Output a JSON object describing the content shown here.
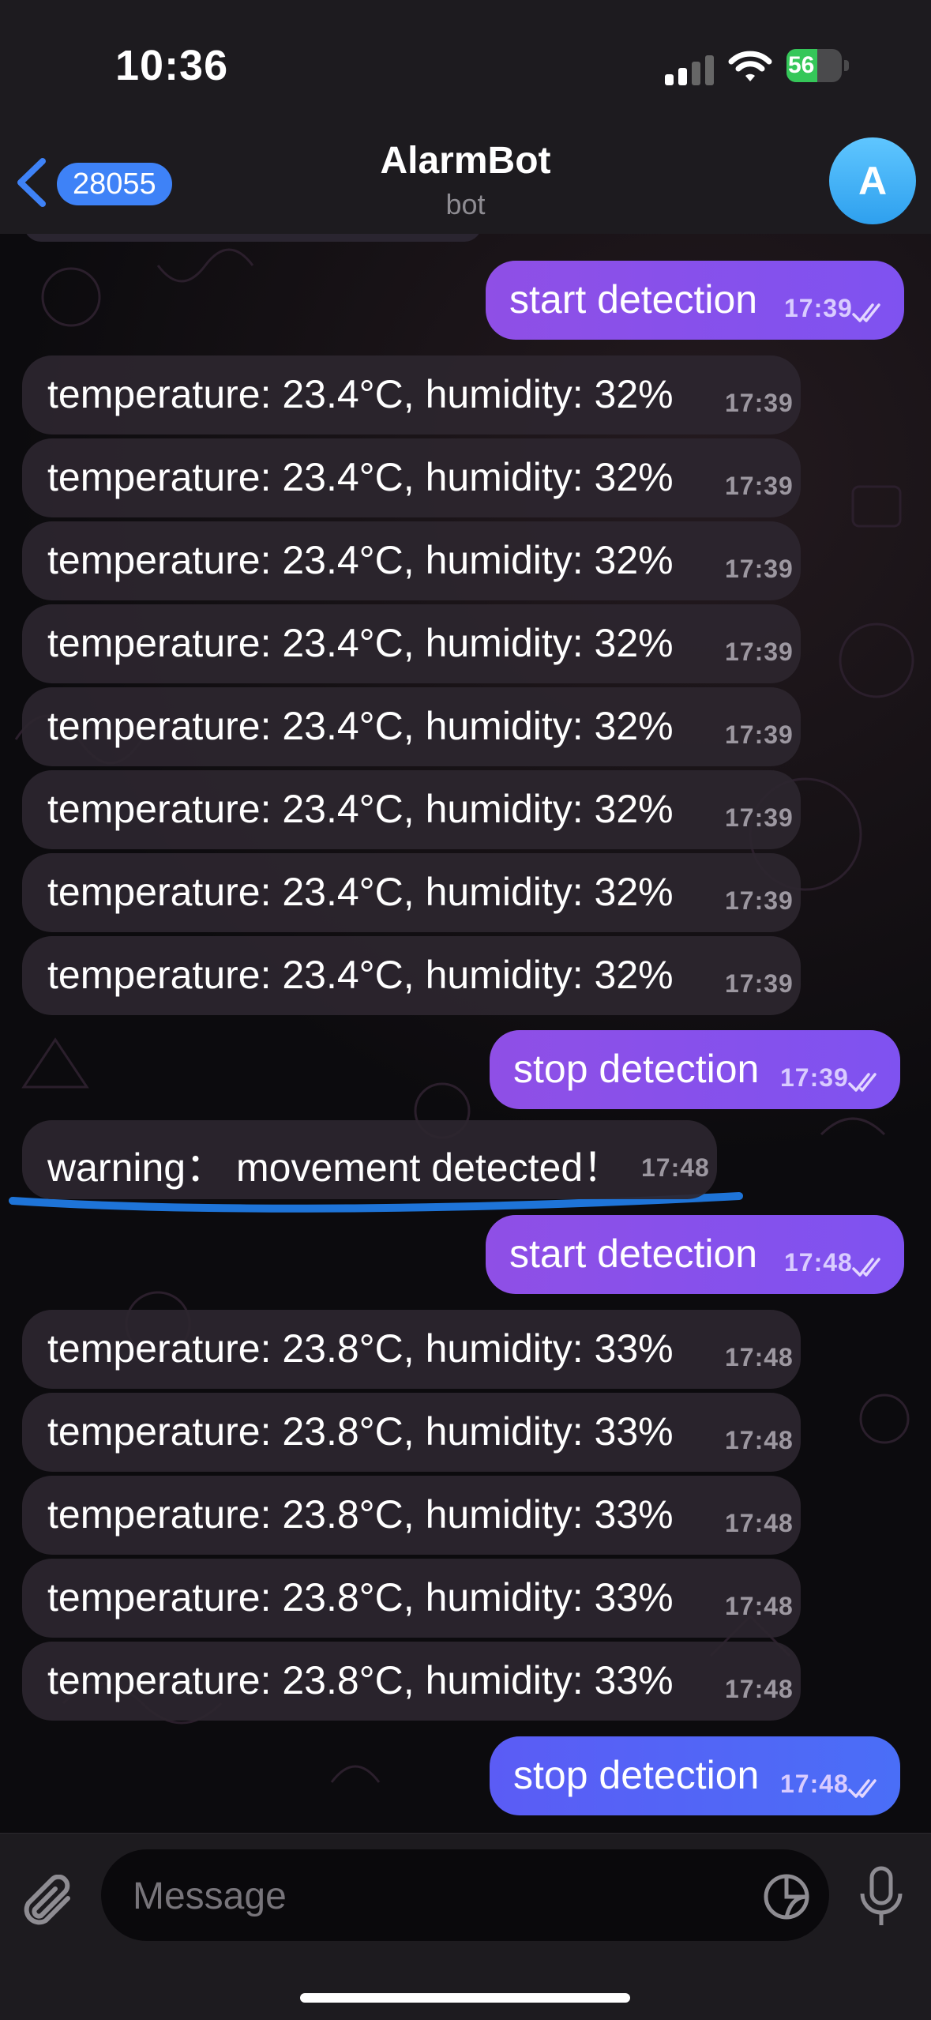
{
  "status_bar": {
    "time": "10:36",
    "battery_percent": 56,
    "battery_label": "56",
    "charging": true
  },
  "header": {
    "back_count": "28055",
    "title": "AlarmBot",
    "subtitle": "bot",
    "avatar_letter": "A"
  },
  "messages": [
    {
      "dir": "out",
      "text": "start detection",
      "time": "17:39",
      "read": true
    },
    {
      "dir": "in",
      "text": "temperature: 23.4°C, humidity: 32%",
      "time": "17:39"
    },
    {
      "dir": "in",
      "text": "temperature: 23.4°C, humidity: 32%",
      "time": "17:39"
    },
    {
      "dir": "in",
      "text": "temperature: 23.4°C, humidity: 32%",
      "time": "17:39"
    },
    {
      "dir": "in",
      "text": "temperature: 23.4°C, humidity: 32%",
      "time": "17:39"
    },
    {
      "dir": "in",
      "text": "temperature: 23.4°C, humidity: 32%",
      "time": "17:39"
    },
    {
      "dir": "in",
      "text": "temperature: 23.4°C, humidity: 32%",
      "time": "17:39"
    },
    {
      "dir": "in",
      "text": "temperature: 23.4°C, humidity: 32%",
      "time": "17:39"
    },
    {
      "dir": "in",
      "text": "temperature: 23.4°C, humidity: 32%",
      "time": "17:39"
    },
    {
      "dir": "out",
      "text": "stop detection",
      "time": "17:39",
      "read": true
    },
    {
      "dir": "in",
      "text": "warning： movement detected！",
      "time": "17:48",
      "highlighted": true
    },
    {
      "dir": "out",
      "text": "start detection",
      "time": "17:48",
      "read": true
    },
    {
      "dir": "in",
      "text": "temperature: 23.8°C, humidity: 33%",
      "time": "17:48"
    },
    {
      "dir": "in",
      "text": "temperature: 23.8°C, humidity: 33%",
      "time": "17:48"
    },
    {
      "dir": "in",
      "text": "temperature: 23.8°C, humidity: 33%",
      "time": "17:48"
    },
    {
      "dir": "in",
      "text": "temperature: 23.8°C, humidity: 33%",
      "time": "17:48"
    },
    {
      "dir": "in",
      "text": "temperature: 23.8°C, humidity: 33%",
      "time": "17:48"
    },
    {
      "dir": "out",
      "text": "stop detection",
      "time": "17:48",
      "read": true
    }
  ],
  "composer": {
    "placeholder": "Message"
  },
  "icons": {
    "back": "chevron-left-icon",
    "signal": "cellular-signal-icon",
    "wifi": "wifi-icon",
    "battery": "battery-charging-icon",
    "attach": "paperclip-icon",
    "sticker": "sticker-icon",
    "mic": "microphone-icon",
    "read_receipt": "double-check-icon"
  },
  "colors": {
    "bar_bg": "#1d1b1f",
    "incoming_bubble": "#2c262e",
    "outgoing_bubble": "#8f4fe6",
    "outgoing_bubble_last": "#4a6ef7",
    "accent": "#3e82f7",
    "highlight_underline": "#1e74d8",
    "battery_green": "#35c759"
  }
}
